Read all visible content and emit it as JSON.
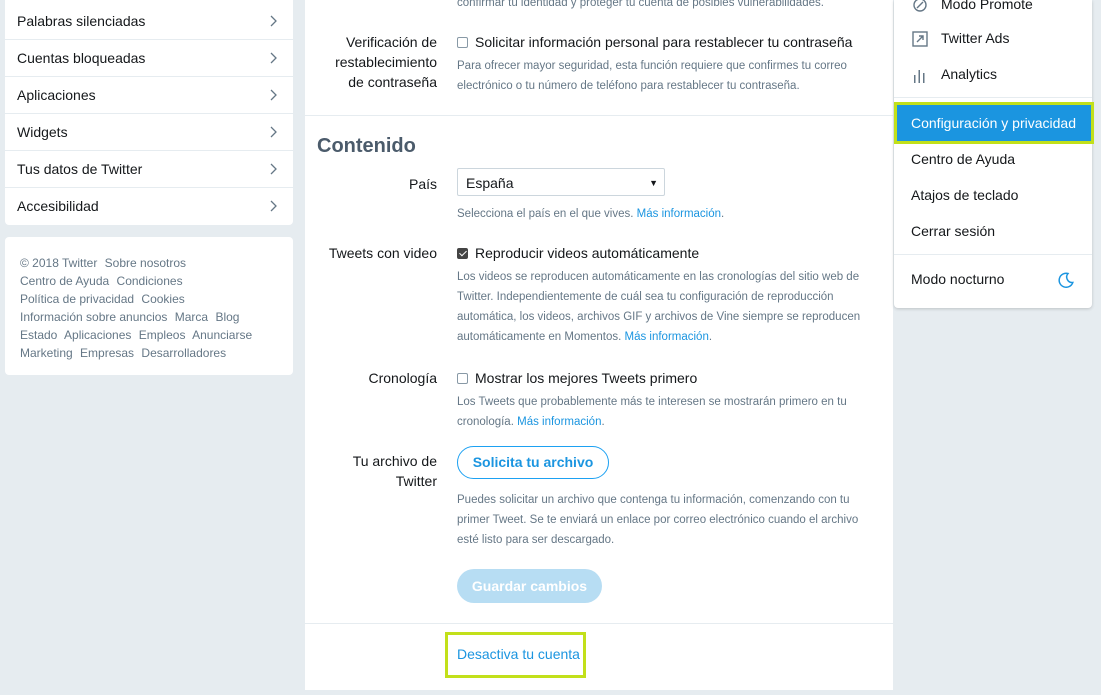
{
  "left_nav": {
    "items": [
      {
        "label": "Palabras silenciadas"
      },
      {
        "label": "Cuentas bloqueadas"
      },
      {
        "label": "Aplicaciones"
      },
      {
        "label": "Widgets"
      },
      {
        "label": "Tus datos de Twitter"
      },
      {
        "label": "Accesibilidad"
      }
    ],
    "chevron_icon": "chevron-right-icon"
  },
  "footer": {
    "copyright": "© 2018 Twitter",
    "links": [
      "Sobre nosotros",
      "Centro de Ayuda",
      "Condiciones",
      "Política de privacidad",
      "Cookies",
      "Información sobre anuncios",
      "Marca",
      "Blog",
      "Estado",
      "Aplicaciones",
      "Empleos",
      "Anunciarse",
      "Marketing",
      "Empresas",
      "Desarrolladores"
    ]
  },
  "main": {
    "top_cut_text": "confirmar tu identidad y proteger tu cuenta de posibles vulnerabilidades.",
    "password_reset": {
      "label_line1": "Verificación de",
      "label_line2": "restablecimiento",
      "label_line3": "de contraseña",
      "checkbox_label": "Solicitar información personal para restablecer tu contraseña",
      "checked": false,
      "help": "Para ofrecer mayor seguridad, esta función requiere que confirmes tu correo electrónico o tu número de teléfono para restablecer tu contraseña."
    },
    "content_title": "Contenido",
    "country": {
      "label": "País",
      "selected": "España",
      "help": "Selecciona el país en el que vives.",
      "more": "Más información"
    },
    "video": {
      "label": "Tweets con video",
      "checkbox_label": "Reproducir videos automáticamente",
      "checked": true,
      "help": "Los videos se reproducen automáticamente en las cronologías del sitio web de Twitter. Independientemente de cuál sea tu configuración de reproducción automática, los videos, archivos GIF y archivos de Vine siempre se reproducen automáticamente en Momentos.",
      "more": "Más información"
    },
    "timeline": {
      "label": "Cronología",
      "checkbox_label": "Mostrar los mejores Tweets primero",
      "checked": false,
      "help": "Los Tweets que probablemente más te interesen se mostrarán primero en tu cronología.",
      "more": "Más información"
    },
    "archive": {
      "label_line1": "Tu archivo de",
      "label_line2": "Twitter",
      "button": "Solicita tu archivo",
      "help": "Puedes solicitar un archivo que contenga tu información, comenzando con tu primer Tweet. Se te enviará un enlace por correo electrónico cuando el archivo esté listo para ser descargado."
    },
    "save_button": "Guardar cambios",
    "deactivate_link": "Desactiva tu cuenta"
  },
  "right_menu": {
    "items_top": [
      {
        "label": "Modo Promote",
        "icon": "promote-icon"
      },
      {
        "label": "Twitter Ads",
        "icon": "ads-arrow-icon"
      },
      {
        "label": "Analytics",
        "icon": "analytics-bars-icon"
      }
    ],
    "highlighted": "Configuración y privacidad",
    "items_mid": [
      {
        "label": "Centro de Ayuda"
      },
      {
        "label": "Atajos de teclado"
      },
      {
        "label": "Cerrar sesión"
      }
    ],
    "night_mode": {
      "label": "Modo nocturno",
      "icon": "moon-icon"
    }
  },
  "colors": {
    "accent": "#1b95e0",
    "highlight_border": "#c2e01a",
    "background": "#e6ecf0"
  }
}
